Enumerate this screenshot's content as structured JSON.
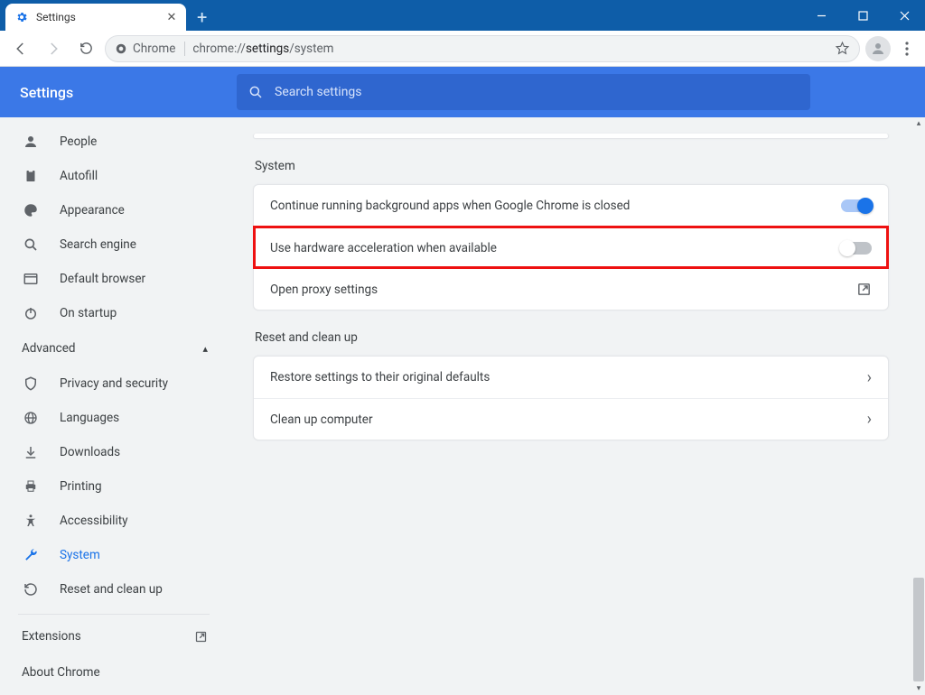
{
  "window": {
    "tab_title": "Settings"
  },
  "omnibox": {
    "chip_label": "Chrome",
    "url_prefix": "chrome://",
    "url_bold": "settings",
    "url_suffix": "/system"
  },
  "header": {
    "title": "Settings",
    "search_placeholder": "Search settings"
  },
  "sidebar": {
    "items": [
      {
        "label": "People"
      },
      {
        "label": "Autofill"
      },
      {
        "label": "Appearance"
      },
      {
        "label": "Search engine"
      },
      {
        "label": "Default browser"
      },
      {
        "label": "On startup"
      }
    ],
    "advanced_label": "Advanced",
    "advanced_items": [
      {
        "label": "Privacy and security"
      },
      {
        "label": "Languages"
      },
      {
        "label": "Downloads"
      },
      {
        "label": "Printing"
      },
      {
        "label": "Accessibility"
      },
      {
        "label": "System"
      },
      {
        "label": "Reset and clean up"
      }
    ],
    "extensions_label": "Extensions",
    "about_label": "About Chrome"
  },
  "sections": {
    "system": {
      "title": "System",
      "rows": {
        "bg_apps": "Continue running background apps when Google Chrome is closed",
        "hw_accel": "Use hardware acceleration when available",
        "proxy": "Open proxy settings"
      }
    },
    "reset": {
      "title": "Reset and clean up",
      "rows": {
        "restore": "Restore settings to their original defaults",
        "cleanup": "Clean up computer"
      }
    }
  },
  "colors": {
    "titlebar": "#0e5da8",
    "header": "#3b78e7",
    "accent": "#1a73e8",
    "highlight": "#e11"
  }
}
